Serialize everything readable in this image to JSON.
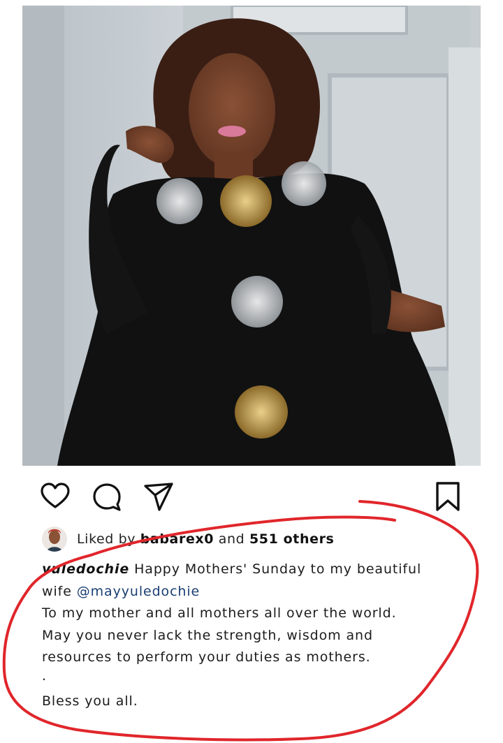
{
  "post": {
    "image_alt": "Woman in a black embellished kaftan posing in front of a grey paneled wall"
  },
  "actions": {
    "like_icon": "heart-icon",
    "comment_icon": "comment-icon",
    "share_icon": "send-icon",
    "save_icon": "bookmark-icon"
  },
  "likes": {
    "prefix": "Liked by",
    "user": "babarex0",
    "connector": "and",
    "others": "551 others"
  },
  "caption": {
    "username": "yuledochie",
    "line1_text": "Happy Mothers' Sunday to my beautiful",
    "line2_prefix": "wife",
    "mention": "@mayyuledochie",
    "line3": "To my mother and all mothers all over the world.",
    "line4": "May you never lack the strength, wisdom and",
    "line5": "resources to perform your duties as mothers.",
    "line6": ".",
    "line7": "Bless you all."
  },
  "colors": {
    "annotation": "#e0262b",
    "mention": "#1a3f73",
    "text": "#1c1c1c"
  }
}
